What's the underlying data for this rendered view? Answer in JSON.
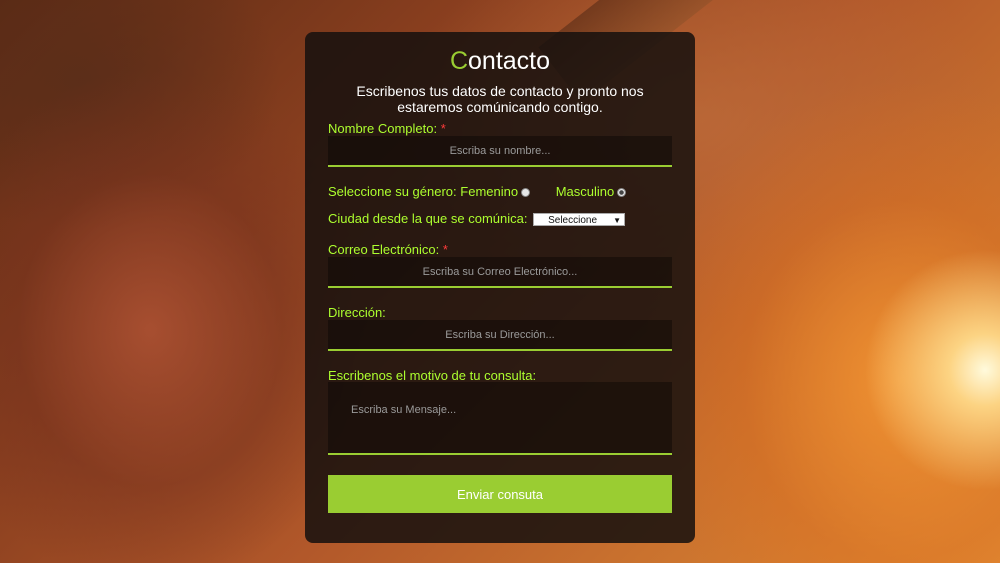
{
  "form": {
    "title_first_letter": "C",
    "title_rest": "ontacto",
    "subtitle": "Escribenos tus datos de contacto y pronto nos estaremos comúnicando contigo.",
    "name_label": "Nombre Completo:",
    "required_mark": "*",
    "name_placeholder": "Escriba su nombre...",
    "gender_label": "Seleccione su género:",
    "gender_options": [
      {
        "label": "Femenino",
        "checked": false
      },
      {
        "label": "Masculino",
        "checked": true
      }
    ],
    "city_label": "Ciudad desde la que se comúnica:",
    "city_selected": "Seleccione",
    "email_label": "Correo Electrónico:",
    "email_placeholder": "Escriba su Correo Electrónico...",
    "address_label": "Dirección:",
    "address_placeholder": "Escriba su Dirección...",
    "message_label": "Escribenos el motivo de tu consulta:",
    "message_placeholder": "Escriba su Mensaje...",
    "submit_label": "Enviar consuta"
  },
  "colors": {
    "accent": "#9acd32",
    "label": "#adff2f",
    "required": "#ff3b3b",
    "panel": "#16100e"
  },
  "icons": {
    "select_arrow": "dropdown-arrow-icon",
    "radio": "radio-icon"
  }
}
